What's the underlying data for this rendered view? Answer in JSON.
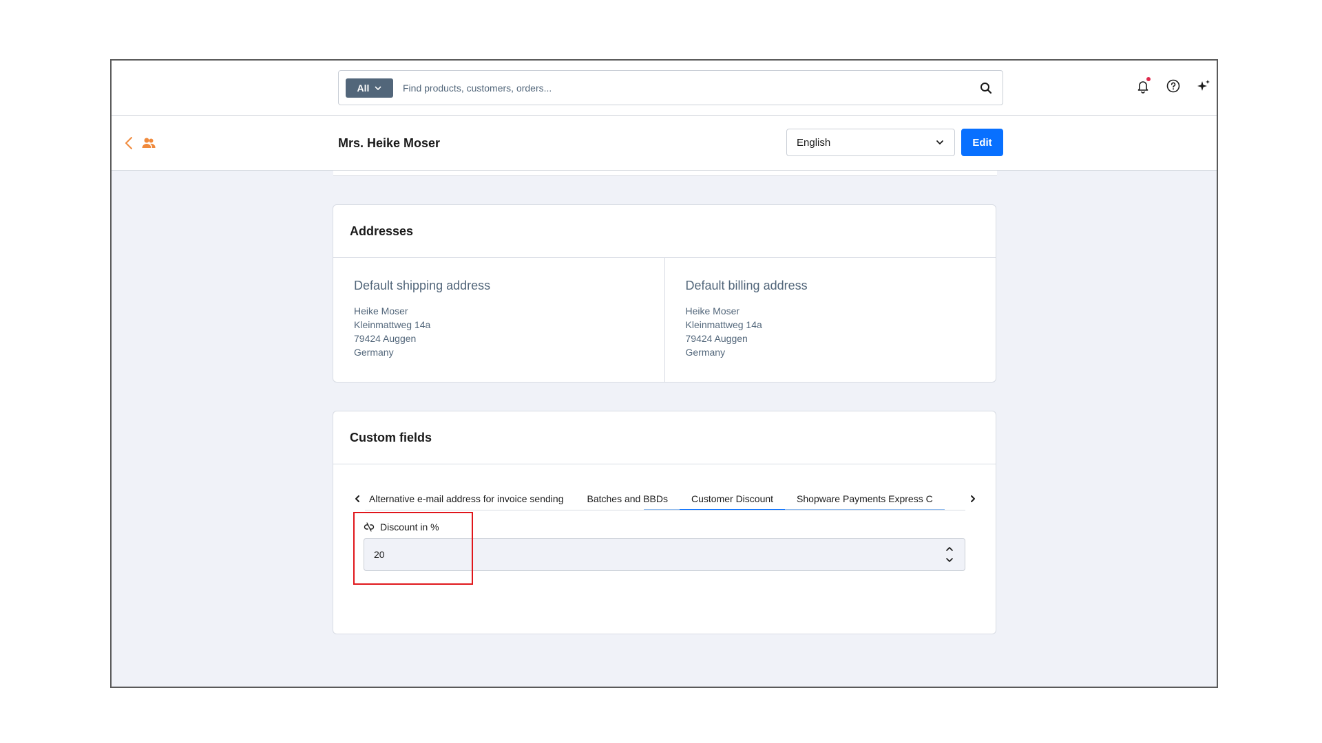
{
  "search": {
    "type_label": "All",
    "placeholder": "Find products, customers, orders..."
  },
  "header": {
    "title": "Mrs. Heike Moser",
    "language": "English",
    "edit_label": "Edit"
  },
  "addresses": {
    "title": "Addresses",
    "shipping": {
      "heading": "Default shipping address",
      "lines": [
        "Heike Moser",
        "Kleinmattweg 14a",
        "79424 Auggen",
        "Germany"
      ]
    },
    "billing": {
      "heading": "Default billing address",
      "lines": [
        "Heike Moser",
        "Kleinmattweg 14a",
        "79424 Auggen",
        "Germany"
      ]
    }
  },
  "custom_fields": {
    "title": "Custom fields",
    "tabs": [
      "Alternative e-mail address for invoice sending",
      "Batches and BBDs",
      "Customer Discount",
      "Shopware Payments Express C"
    ],
    "active_tab": "Customer Discount",
    "field": {
      "label": "Discount in %",
      "value": "20"
    }
  },
  "colors": {
    "accent": "#0870ff",
    "brand_orange": "#f08a3c",
    "highlight": "#e0161b",
    "notification": "#de294c"
  },
  "icons": [
    "search-icon",
    "bell-icon",
    "help-icon",
    "sparkle-icon",
    "back-icon",
    "customers-icon",
    "chevron-down-icon",
    "inheritance-link-icon"
  ]
}
